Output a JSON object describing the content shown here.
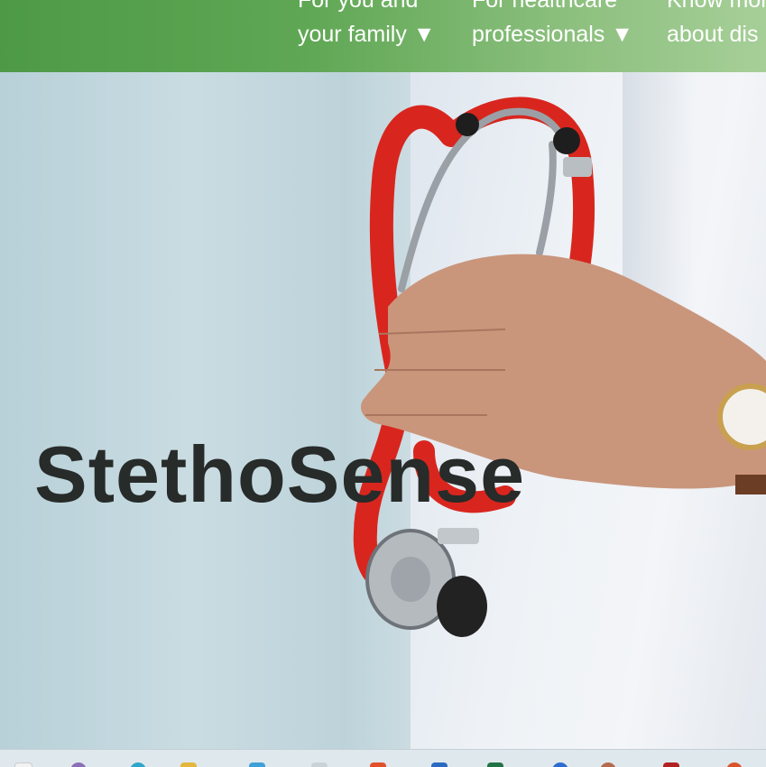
{
  "nav": {
    "items": [
      {
        "line1": "For you and",
        "line2": "your family ▼"
      },
      {
        "line1": "For healthcare",
        "line2": "professionals ▼"
      },
      {
        "line1": "Know more",
        "line2": "about dis"
      }
    ]
  },
  "hero": {
    "title": "StethoSense"
  },
  "taskbar": {
    "icons": [
      "file-explorer-icon",
      "app-icon",
      "edge-icon",
      "folder-icon",
      "app-icon",
      "app-icon",
      "office-icon",
      "app-icon",
      "excel-icon",
      "app-icon",
      "app-icon",
      "app-icon",
      "app-icon"
    ]
  },
  "colors": {
    "nav_green": "#5fa754",
    "title": "#272b29",
    "tube_red": "#d8261e"
  }
}
